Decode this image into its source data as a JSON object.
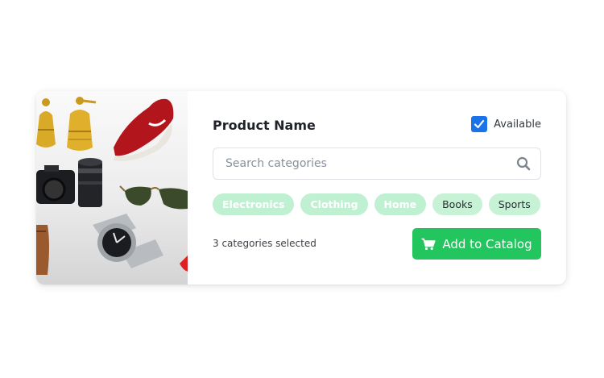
{
  "product": {
    "title": "Product Name",
    "available_label": "Available",
    "available_checked": true
  },
  "search": {
    "placeholder": "Search categories",
    "value": ""
  },
  "categories": [
    {
      "label": "Electronics",
      "selected": true
    },
    {
      "label": "Clothing",
      "selected": true
    },
    {
      "label": "Home",
      "selected": true
    },
    {
      "label": "Books",
      "selected": false
    },
    {
      "label": "Sports",
      "selected": false
    }
  ],
  "status": {
    "selected_count_text": "3 categories selected"
  },
  "actions": {
    "add_label": "Add to Catalog"
  },
  "colors": {
    "accent_green": "#22c55e",
    "checkbox_blue": "#1a73e8",
    "tag_bg": "#c8f2d6"
  },
  "icons": {
    "search": "search-icon",
    "cart": "cart-icon",
    "check": "checkmark-icon"
  }
}
